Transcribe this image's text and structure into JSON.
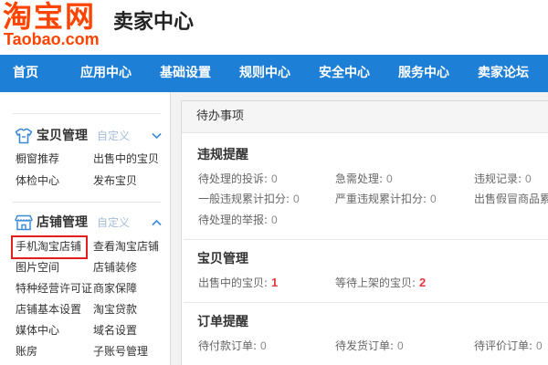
{
  "header": {
    "logo_cn": "淘宝网",
    "logo_en": "Taobao.com",
    "title": "卖家中心"
  },
  "nav": {
    "items": [
      "首页",
      "应用中心",
      "基础设置",
      "规则中心",
      "安全中心",
      "服务中心",
      "卖家论坛"
    ]
  },
  "sidebar": {
    "sections": [
      {
        "title": "宝贝管理",
        "customize": "自定义",
        "icon": "shirt-icon",
        "toggle_icon": "chevron-down-icon",
        "items": [
          "橱窗推荐",
          "出售中的宝贝",
          "体检中心",
          "发布宝贝"
        ]
      },
      {
        "title": "店铺管理",
        "customize": "自定义",
        "icon": "store-icon",
        "toggle_icon": "chevron-up-icon",
        "items": [
          "手机淘宝店铺",
          "查看淘宝店铺",
          "图片空间",
          "店铺装修",
          "特种经营许可证",
          "商家保障",
          "店铺基本设置",
          "淘宝贷款",
          "媒体中心",
          "域名设置",
          "账房",
          "子账号管理"
        ],
        "highlighted_index": 0
      }
    ]
  },
  "main": {
    "panel_title": "待办事项",
    "sections": [
      {
        "title": "违规提醒",
        "rows": [
          [
            {
              "label": "待处理的投诉:",
              "value": "0"
            },
            {
              "label": "急需处理:",
              "value": "0"
            },
            {
              "label": "违规记录:",
              "value": "0"
            }
          ],
          [
            {
              "label": "一般违规累计扣分:",
              "value": "0"
            },
            {
              "label": "严重违规累计扣分:",
              "value": "0"
            },
            {
              "label": "出售假冒商品累"
            }
          ],
          [
            {
              "label": "待处理的举报:",
              "value": "0"
            }
          ]
        ]
      },
      {
        "title": "宝贝管理",
        "rows": [
          [
            {
              "label": "出售中的宝贝:",
              "value": "1"
            },
            {
              "label": "等待上架的宝贝:",
              "value": "2"
            }
          ]
        ]
      },
      {
        "title": "订单提醒",
        "rows": [
          [
            {
              "label": "待付款订单:",
              "value": "0"
            },
            {
              "label": "待发货订单:",
              "value": "0"
            },
            {
              "label": "待评价订单:",
              "value": "0"
            }
          ]
        ]
      }
    ]
  },
  "colors": {
    "nav_bar": "#1e7fd6",
    "logo": "#ff4400",
    "sidebar_icon": "#3a8ad8",
    "customize_link": "#a4bcd8",
    "value_emphasis": "#e4393c",
    "highlight_box": "#e0201f"
  }
}
